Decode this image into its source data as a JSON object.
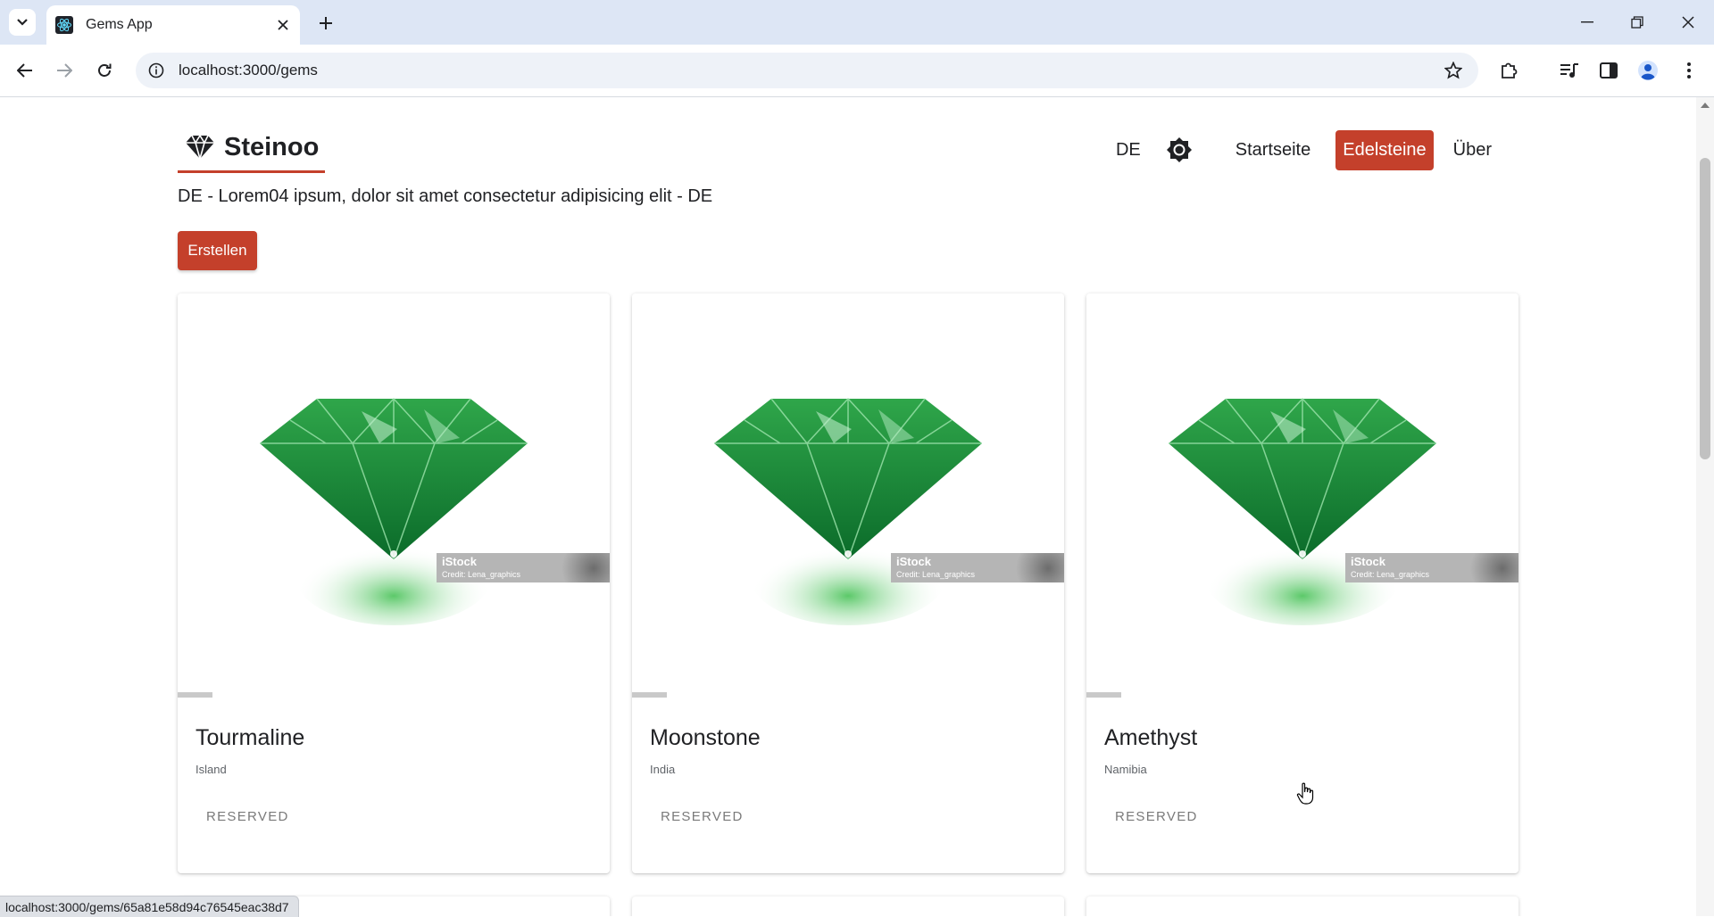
{
  "browser": {
    "tab_title": "Gems App",
    "url": "localhost:3000/gems",
    "status_url": "localhost:3000/gems/65a81e58d94c76545eac38d7"
  },
  "header": {
    "brand": "Steinoo",
    "language": "DE",
    "nav": [
      {
        "label": "Startseite",
        "active": false
      },
      {
        "label": "Edelsteine",
        "active": true
      },
      {
        "label": "Über",
        "active": false
      }
    ]
  },
  "intro_text": "DE - Lorem04 ipsum, dolor sit amet consectetur adipisicing elit - DE",
  "create_label": "Erstellen",
  "watermark": {
    "brand": "iStock",
    "credit": "Credit: Lena_graphics"
  },
  "gems": [
    {
      "name": "Tourmaline",
      "origin": "Island",
      "status": "RESERVED"
    },
    {
      "name": "Moonstone",
      "origin": "India",
      "status": "RESERVED"
    },
    {
      "name": "Amethyst",
      "origin": "Namibia",
      "status": "RESERVED"
    }
  ],
  "colors": {
    "accent": "#c4402b",
    "chrome": "#dde6f5"
  }
}
